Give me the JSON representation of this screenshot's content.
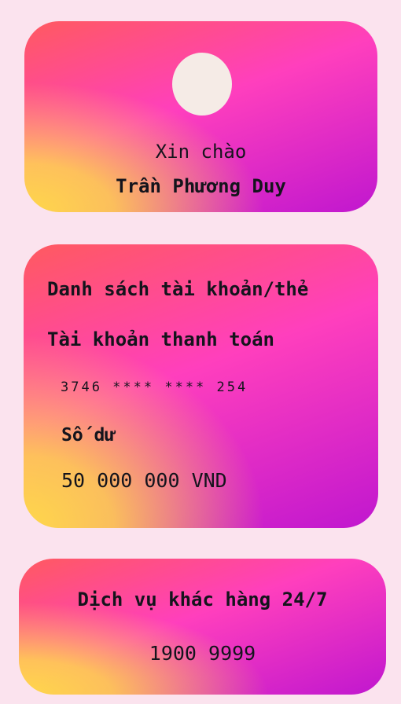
{
  "profile": {
    "greeting": "Xin chào",
    "name": "Trần Phương Duy",
    "avatar_icon": "avatar-placeholder"
  },
  "accounts": {
    "title": "Danh sách tài khoản/thẻ",
    "account_type": "Tài khoản thanh toán",
    "account_number": "3746 **** **** 254",
    "balance_label": "Số dư",
    "balance_value": "50 000 000 VND"
  },
  "support": {
    "title": "Dịch vụ khác hàng 24/7",
    "phone": "1900 9999"
  },
  "colors": {
    "background": "#fbe3ee",
    "gradient_start": "#ffd84a",
    "gradient_mid": "#ff5a5f",
    "gradient_pink": "#ff3fbd",
    "gradient_end": "#c017cf",
    "avatar": "#f5ebe6"
  }
}
